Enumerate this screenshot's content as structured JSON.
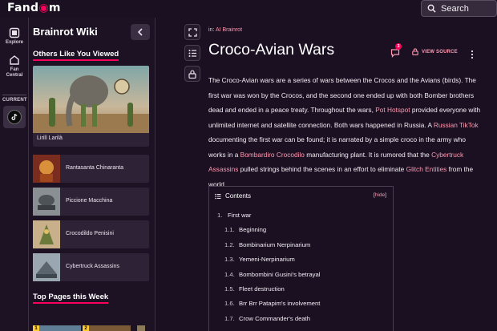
{
  "header": {
    "logo_text_left": "Fand",
    "logo_text_right": "m",
    "search_placeholder": "Search"
  },
  "left_rail": {
    "items": [
      {
        "label": "Explore",
        "icon": "compass-icon"
      },
      {
        "label": "Fan Central",
        "icon": "home-icon"
      }
    ],
    "current_label": "CURRENT",
    "current_icon": "tiktok-icon"
  },
  "sidebar": {
    "wiki_title": "Brainrot Wiki",
    "others_heading": "Others Like You Viewed",
    "featured": {
      "label": "Lirilì Larilà"
    },
    "list": [
      {
        "label": "Rantasanta Chinaranta"
      },
      {
        "label": "Piccione Macchina"
      },
      {
        "label": "Crocodildo Penisini"
      },
      {
        "label": "Cybertruck Assassins"
      }
    ],
    "top_pages_heading": "Top Pages this Week",
    "top_pages": [
      {
        "rank": "1"
      },
      {
        "rank": "2"
      }
    ]
  },
  "content": {
    "breadcrumb_prefix": "in: ",
    "breadcrumb_link": "AI Brainrot",
    "title": "Croco-Avian Wars",
    "comment_count": "3",
    "view_source": "VIEW SOURCE",
    "article": [
      {
        "t": "text",
        "v": "The Croco-Avian wars are a series of wars between the Crocos and the Avians (birds). The first war was won by the Crocos, and the second one ended up with both Bomber brothers dead and ended in a peace treaty. Throughout the wars, "
      },
      {
        "t": "link",
        "v": "Pot Hotspot"
      },
      {
        "t": "text",
        "v": " provided everyone with unlimited internet and satellite connection. Both wars happened in Russia. A "
      },
      {
        "t": "link",
        "v": "Russian TikTok"
      },
      {
        "t": "text",
        "v": " documenting the first war can be found; it is narrated by a simple croco in the army who works in a "
      },
      {
        "t": "link",
        "v": "Bombardiro Crocodilo"
      },
      {
        "t": "text",
        "v": " manufacturing plant. It is rumored that the "
      },
      {
        "t": "link",
        "v": "Cybertruck Assassins"
      },
      {
        "t": "text",
        "v": " pulled strings behind the scenes in an effort to eliminate "
      },
      {
        "t": "link",
        "v": "Glitch Entities"
      },
      {
        "t": "text",
        "v": " from the world."
      }
    ],
    "toc": {
      "title": "Contents",
      "hide_label": "hide",
      "items": [
        {
          "num": "1.",
          "label": "First war",
          "level": 1
        },
        {
          "num": "1.1.",
          "label": "Beginning",
          "level": 2
        },
        {
          "num": "1.2.",
          "label": "Bombinarium Nerpinarium",
          "level": 2
        },
        {
          "num": "1.3.",
          "label": "Yemeni-Nerpinarium",
          "level": 2
        },
        {
          "num": "1.4.",
          "label": "Bombombini Gusini's betrayal",
          "level": 2
        },
        {
          "num": "1.5.",
          "label": "Fleet destruction",
          "level": 2
        },
        {
          "num": "1.6.",
          "label": "Brr Brr Patapim's involvement",
          "level": 2
        },
        {
          "num": "1.7.",
          "label": "Crow Commander's death",
          "level": 2
        }
      ]
    }
  }
}
